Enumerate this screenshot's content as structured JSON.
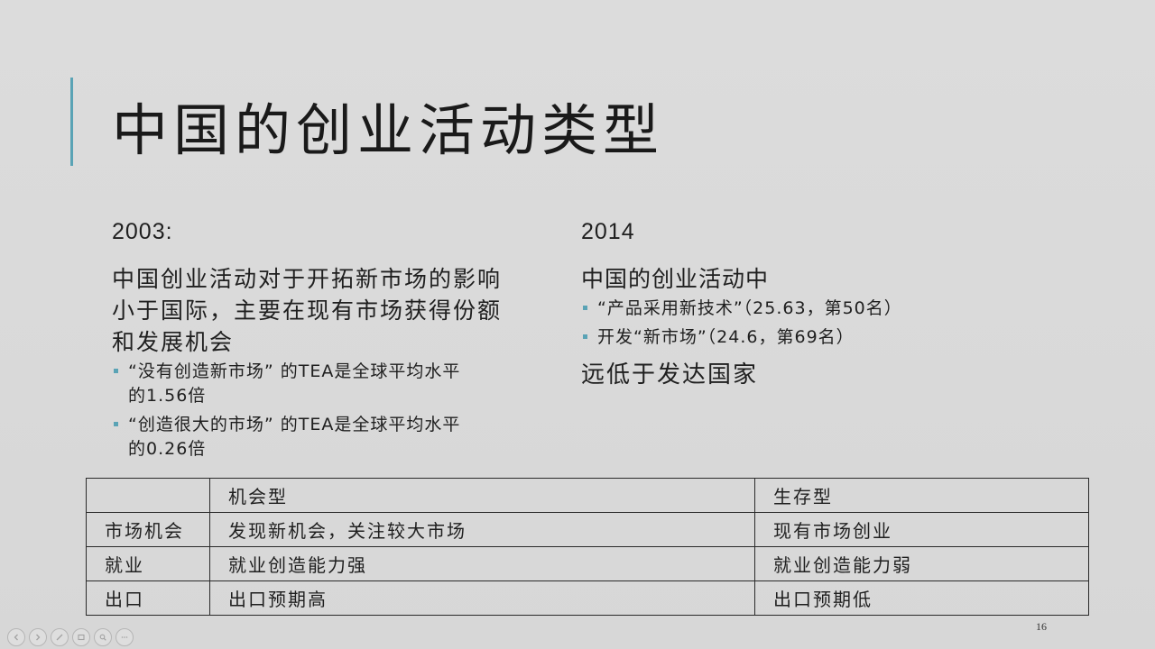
{
  "slide": {
    "title": "中国的创业活动类型",
    "page_number": "16",
    "accent_color": "#5aa3b5"
  },
  "left": {
    "year": "2003:",
    "lead_lines": [
      "中国创业活动对于开拓新市场的影响",
      "小于国际，主要在现有市场获得份额",
      "和发展机会"
    ],
    "bullets": [
      {
        "line1": "“没有创造新市场” 的TEA是全球平均水平",
        "line2": "的1.56倍"
      },
      {
        "line1": "“创造很大的市场” 的TEA是全球平均水平",
        "line2": "的0.26倍"
      }
    ]
  },
  "right": {
    "year": "2014",
    "lead": "中国的创业活动中",
    "bullets": [
      "“产品采用新技术”（25.63，第50名）",
      "开发“新市场”（24.6，第69名）"
    ],
    "conclusion": "远低于发达国家"
  },
  "table": {
    "header": [
      "",
      "机会型",
      "生存型"
    ],
    "rows": [
      [
        "市场机会",
        "发现新机会，关注较大市场",
        "现有市场创业"
      ],
      [
        "就业",
        "就业创造能力强",
        "就业创造能力弱"
      ],
      [
        "出口",
        "出口预期高",
        "出口预期低"
      ]
    ]
  },
  "toolbar": {
    "icons": [
      "prev-icon",
      "next-icon",
      "pen-icon",
      "slides-icon",
      "zoom-icon",
      "more-icon"
    ]
  }
}
